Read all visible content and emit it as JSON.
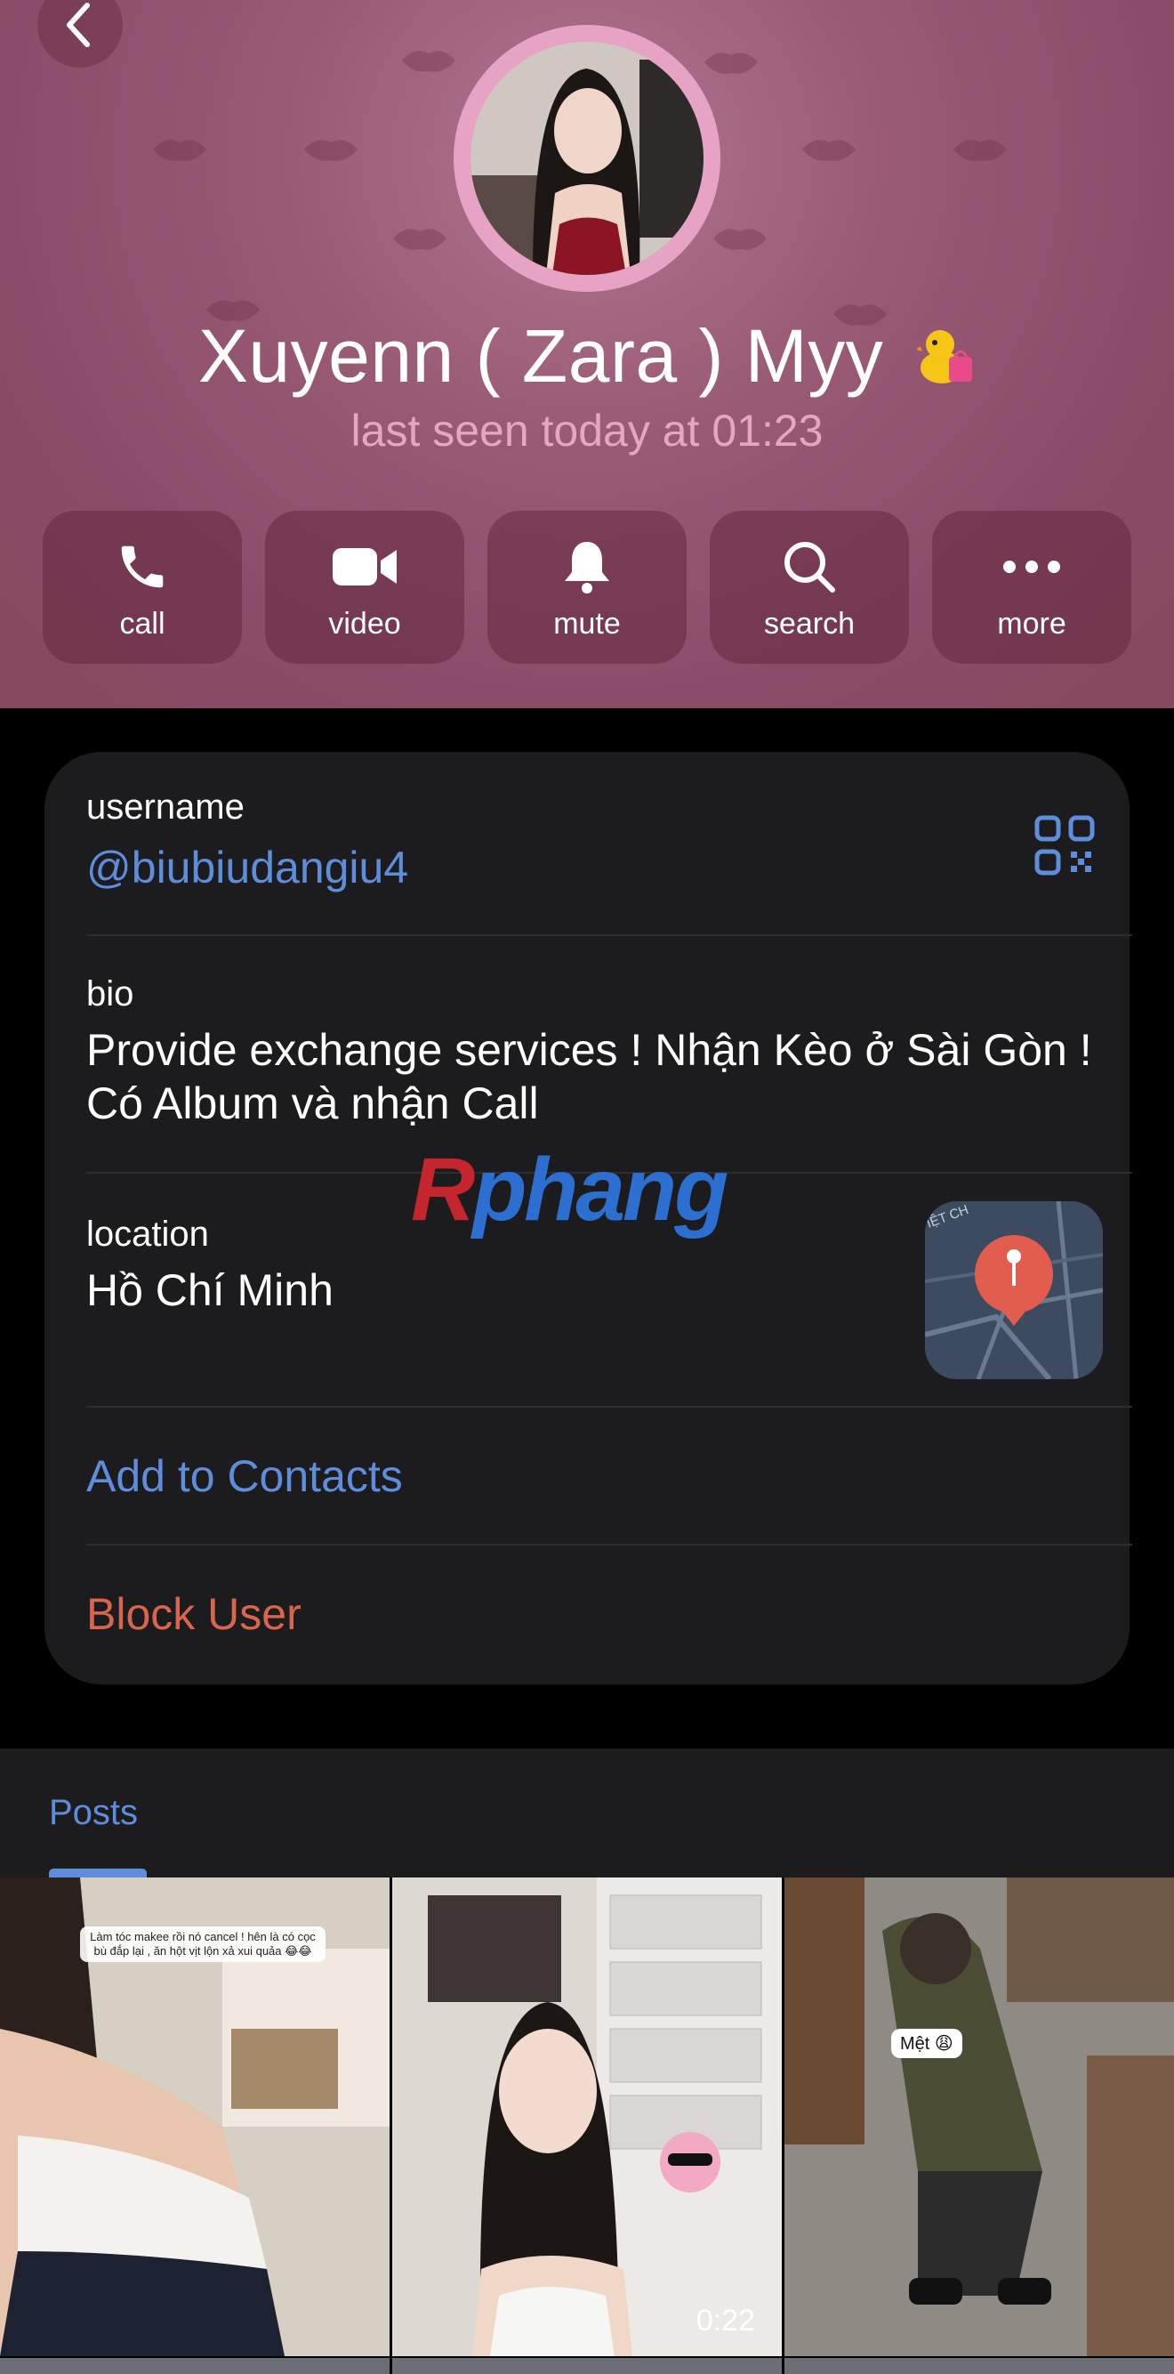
{
  "profile": {
    "name": "Xuyenn ( Zara ) Myy",
    "status": "last seen today at 01:23"
  },
  "actions": [
    {
      "label": "call",
      "icon": "phone-icon"
    },
    {
      "label": "video",
      "icon": "video-camera-icon"
    },
    {
      "label": "mute",
      "icon": "bell-icon"
    },
    {
      "label": "search",
      "icon": "search-icon"
    },
    {
      "label": "more",
      "icon": "more-dots-icon"
    }
  ],
  "info": {
    "username_label": "username",
    "username": "@biubiudangiu4",
    "bio_label": "bio",
    "bio_line1": "Provide exchange services ! Nhận Kèo ở Sài Gòn !",
    "bio_line2": "Có Album và nhận Call",
    "location_label": "location",
    "location": "Hồ Chí Minh",
    "add_contact": "Add to Contacts",
    "block_user": "Block User"
  },
  "map_label": "IỆT CH",
  "watermark": {
    "first": "R",
    "rest": "phang"
  },
  "posts": {
    "tab_label": "Posts",
    "items": [
      {
        "caption": "Làm tóc makee rồi nó cancel ! hên là có cọc bù đắp lại , ăn hột vịt lộn xả xui quảa 😂😂"
      },
      {
        "duration": "0:22"
      },
      {
        "sticker": "Mệt 😩"
      }
    ]
  },
  "colors": {
    "header": "#8a4c68",
    "accent": "#5e8ddb",
    "danger": "#d9654f",
    "card": "#1c1c1e"
  }
}
